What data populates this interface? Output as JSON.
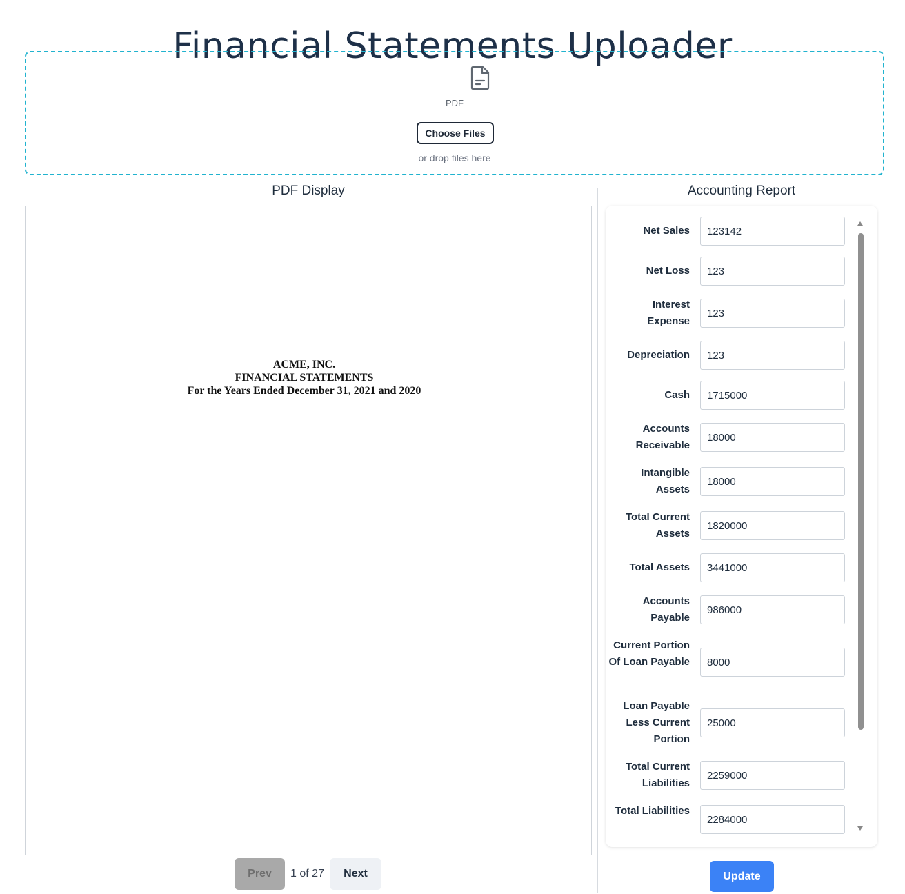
{
  "app": {
    "title": "Financial Statements Uploader"
  },
  "uploader": {
    "file_type": "PDF",
    "choose_label": "Choose Files",
    "hint": "or drop files here",
    "icon": "file-icon"
  },
  "pdf_panel": {
    "title": "PDF Display",
    "document_lines": [
      "ACME, INC.",
      "FINANCIAL STATEMENTS",
      "For the Years Ended December 31, 2021 and 2020"
    ],
    "pager": {
      "prev_label": "Prev",
      "page_info": "1 of 27",
      "next_label": "Next",
      "current_page": 1,
      "total_pages": 27
    }
  },
  "report": {
    "title": "Accounting Report",
    "update_label": "Update",
    "fields": [
      {
        "label": "Net Sales",
        "value": "123142"
      },
      {
        "label": "Net Loss",
        "value": "123"
      },
      {
        "label": "Interest Expense",
        "value": "123"
      },
      {
        "label": "Depreciation",
        "value": "123"
      },
      {
        "label": "Cash",
        "value": "1715000"
      },
      {
        "label": "Accounts Receivable",
        "value": "18000"
      },
      {
        "label": "Intangible Assets",
        "value": "18000"
      },
      {
        "label": "Total Current Assets",
        "value": "1820000"
      },
      {
        "label": "Total Assets",
        "value": "3441000"
      },
      {
        "label": "Accounts Payable",
        "value": "986000"
      },
      {
        "label": "Current Portion Of Loan Payable",
        "value": "8000"
      },
      {
        "label": "Loan Payable Less Current Portion",
        "value": "25000"
      },
      {
        "label": "Total Current Liabilities",
        "value": "2259000"
      },
      {
        "label": "Total Liabilities",
        "value": "2284000"
      }
    ]
  },
  "colors": {
    "dropzone_border": "#21b3cf",
    "primary_button": "#3b82f6",
    "disabled_button": "#a9a9a9"
  }
}
